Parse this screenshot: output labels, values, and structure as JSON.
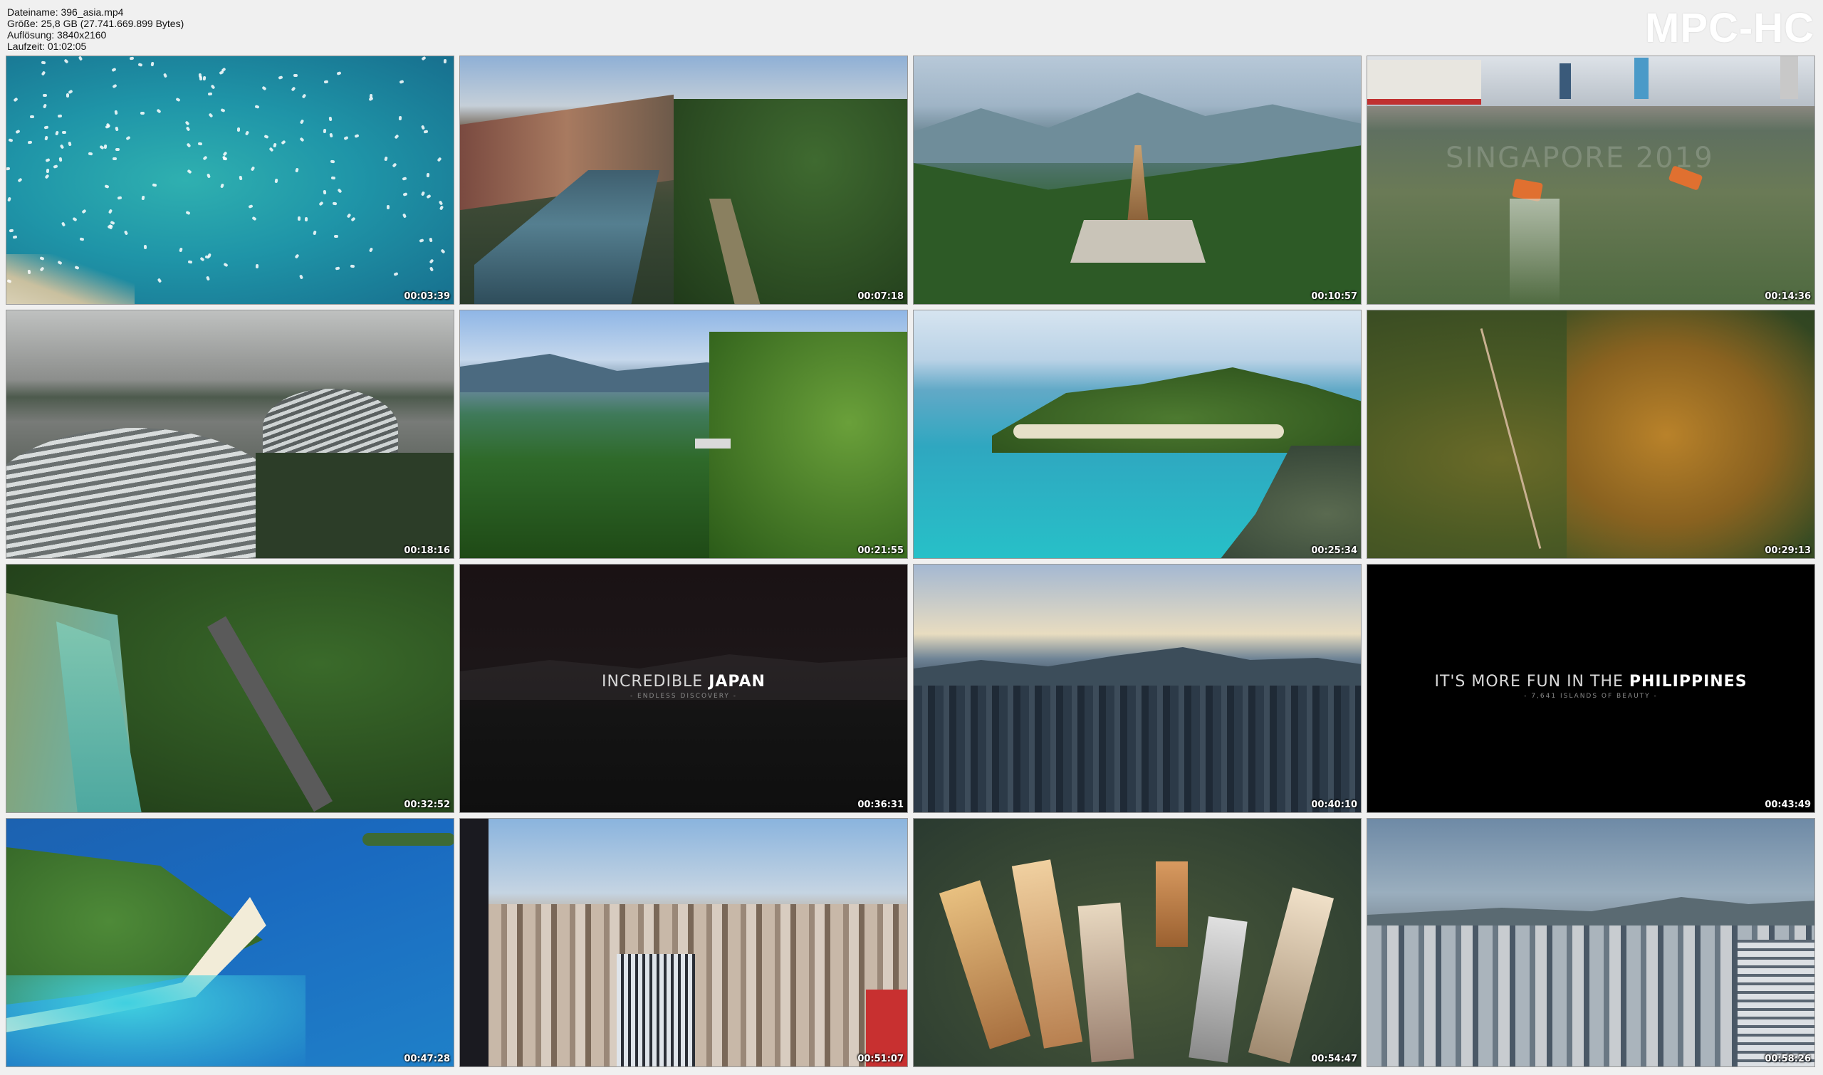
{
  "info": {
    "filename": "Dateiname: 396_asia.mp4",
    "size": "Größe: 25,8 GB (27.741.669.899 Bytes)",
    "resolution": "Auflösung: 3840x2160",
    "duration": "Laufzeit: 01:02:05"
  },
  "logo": "MPC-HC",
  "thumbnails": [
    {
      "timestamp": "00:03:39",
      "scene": "boats-bay"
    },
    {
      "timestamp": "00:07:18",
      "scene": "canal-town"
    },
    {
      "timestamp": "00:10:57",
      "scene": "pagoda-mountains"
    },
    {
      "timestamp": "00:14:36",
      "scene": "singapore-river",
      "watermark": "SINGAPORE 2019"
    },
    {
      "timestamp": "00:18:16",
      "scene": "gardens-domes"
    },
    {
      "timestamp": "00:21:55",
      "scene": "jungle-coast"
    },
    {
      "timestamp": "00:25:34",
      "scene": "island-cove"
    },
    {
      "timestamp": "00:29:13",
      "scene": "autumn-forest"
    },
    {
      "timestamp": "00:32:52",
      "scene": "river-railway"
    },
    {
      "timestamp": "00:36:31",
      "scene": "dark-title",
      "title_pre": "INCREDIBLE",
      "title_bold": "JAPAN",
      "subtitle": "- ENDLESS DISCOVERY -"
    },
    {
      "timestamp": "00:40:10",
      "scene": "town-sunset"
    },
    {
      "timestamp": "00:43:49",
      "scene": "black-title",
      "title_pre": "IT'S MORE FUN IN THE",
      "title_bold": "PHILIPPINES",
      "subtitle": "- 7,641 ISLANDS OF BEAUTY -"
    },
    {
      "timestamp": "00:47:28",
      "scene": "beach-spit"
    },
    {
      "timestamp": "00:51:07",
      "scene": "city-skyline"
    },
    {
      "timestamp": "00:54:47",
      "scene": "skyscrapers-top"
    },
    {
      "timestamp": "00:58:26",
      "scene": "hazy-city"
    }
  ]
}
